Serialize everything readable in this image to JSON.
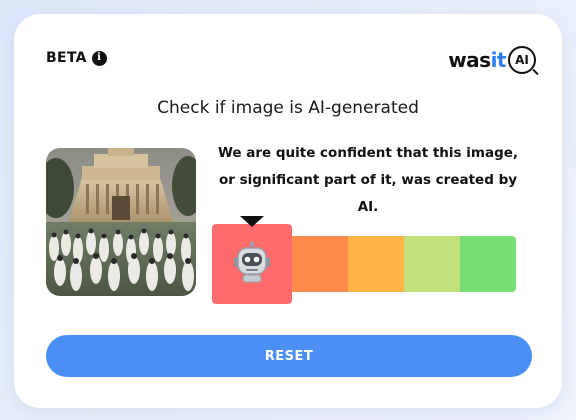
{
  "header": {
    "beta_label": "BETA",
    "info_icon": "info-icon",
    "logo": {
      "part_was": "was",
      "part_it": "it",
      "part_ai": "AI"
    }
  },
  "headline": "Check if image is AI-generated",
  "result": {
    "message": "We are quite confident that this image, or significant part of it, was created by AI.",
    "level": 1,
    "level_count": 5,
    "indicator_icon": "robot-icon",
    "level_colors": [
      "#ff6b6b",
      "#ff8c4b",
      "#ffb347",
      "#bfe07a",
      "#77de77"
    ]
  },
  "image": {
    "description_icon": "uploaded-image"
  },
  "actions": {
    "reset_label": "RESET"
  },
  "colors": {
    "accent": "#4b8ff5",
    "logo_it": "#2f7df1"
  }
}
